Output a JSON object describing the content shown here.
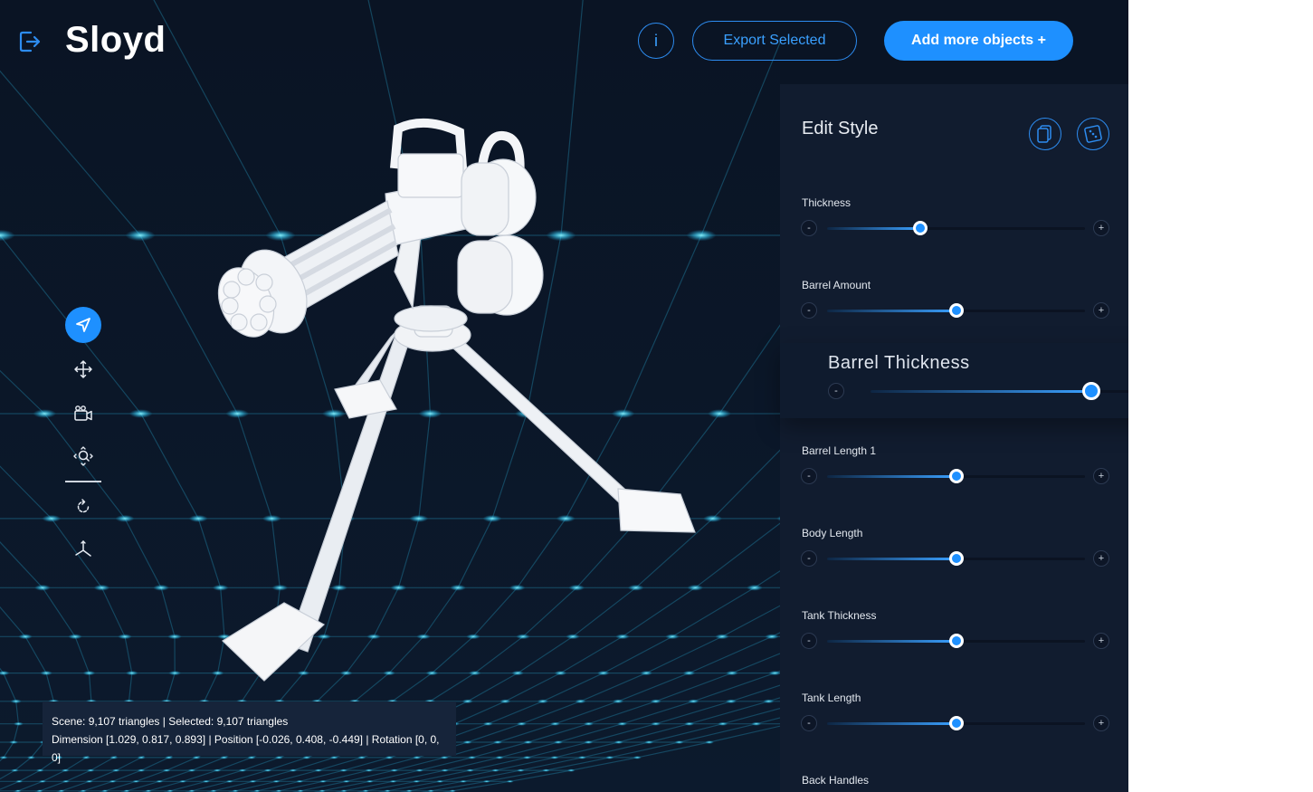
{
  "header": {
    "brand": "Sloyd",
    "info_label": "i",
    "export_label": "Export Selected",
    "add_label": "Add more objects +"
  },
  "toolbar": {
    "tools": [
      "select-icon",
      "move-icon",
      "camera-icon",
      "zoom-icon",
      "rotate-icon",
      "axes-icon"
    ],
    "active": "select-icon"
  },
  "info": {
    "scene_line": "Scene: 9,107 triangles | Selected: 9,107 triangles",
    "dimension_line": "Dimension [1.029, 0.817, 0.893] | Position [-0.026, 0.408, -0.449] | Rotation [0, 0, 0]"
  },
  "panel": {
    "title": "Edit Style",
    "icons": [
      "copy-icon",
      "randomize-icon"
    ],
    "params": [
      {
        "label": "Thickness",
        "value": 0.36
      },
      {
        "label": "Barrel Amount",
        "value": 0.5
      },
      {
        "label": "Barrel Length 1",
        "value": 0.5
      },
      {
        "label": "Body Length",
        "value": 0.5
      },
      {
        "label": "Tank Thickness",
        "value": 0.5
      },
      {
        "label": "Tank Length",
        "value": 0.5
      },
      {
        "label": "Back Handles",
        "value": null
      }
    ],
    "minus": "-",
    "plus": "+"
  },
  "zoom_card": {
    "label": "Barrel Thickness",
    "value": 0.62
  },
  "colors": {
    "background": "#0a1424",
    "panel": "#111c2f",
    "accent": "#1e90ff",
    "grid_glow": "#4fe3ff"
  }
}
